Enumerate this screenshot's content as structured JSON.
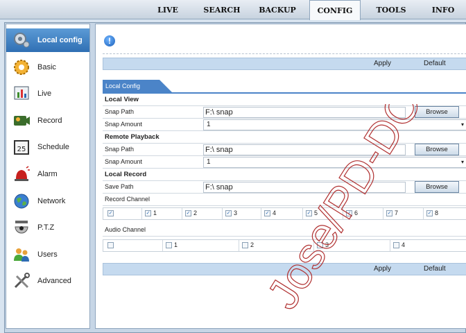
{
  "nav": {
    "tabs": [
      "LIVE",
      "SEARCH",
      "BACKUP",
      "CONFIG",
      "TOOLS",
      "INFO"
    ],
    "active": "CONFIG"
  },
  "sidebar": {
    "items": [
      {
        "label": "Local config",
        "icon": "gear-icon",
        "active": true
      },
      {
        "label": "Basic",
        "icon": "cog-icon"
      },
      {
        "label": "Live",
        "icon": "chart-icon"
      },
      {
        "label": "Record",
        "icon": "record-icon"
      },
      {
        "label": "Schedule",
        "icon": "calendar-icon"
      },
      {
        "label": "Alarm",
        "icon": "alarm-icon"
      },
      {
        "label": "Network",
        "icon": "globe-icon"
      },
      {
        "label": "P.T.Z",
        "icon": "camera-icon"
      },
      {
        "label": "Users",
        "icon": "users-icon"
      },
      {
        "label": "Advanced",
        "icon": "tools-icon"
      }
    ]
  },
  "actions": {
    "apply": "Apply",
    "default": "Default"
  },
  "section_title": "Local Config",
  "local_view": {
    "title": "Local View",
    "snap_path_label": "Snap Path",
    "snap_path": "F:\\ snap",
    "snap_amount_label": "Snap Amount",
    "snap_amount": "1",
    "browse": "Browse"
  },
  "remote_playback": {
    "title": "Remote Playback",
    "snap_path_label": "Snap Path",
    "snap_path": "F:\\ snap",
    "snap_amount_label": "Snap Amount",
    "snap_amount": "1",
    "browse": "Browse"
  },
  "local_record": {
    "title": "Local Record",
    "save_path_label": "Save Path",
    "save_path": "F:\\ snap",
    "browse": "Browse",
    "record_channel_label": "Record Channel",
    "record_channels": [
      "1",
      "2",
      "3",
      "4",
      "5",
      "6",
      "7",
      "8"
    ],
    "audio_channel_label": "Audio Channel",
    "audio_channels": [
      "1",
      "2",
      "3",
      "4"
    ]
  },
  "watermark_text": "Jose/PD-DO",
  "colors": {
    "accent": "#4b84c8",
    "bar": "#c5daef",
    "active_sidebar": "#2f6fb4"
  }
}
